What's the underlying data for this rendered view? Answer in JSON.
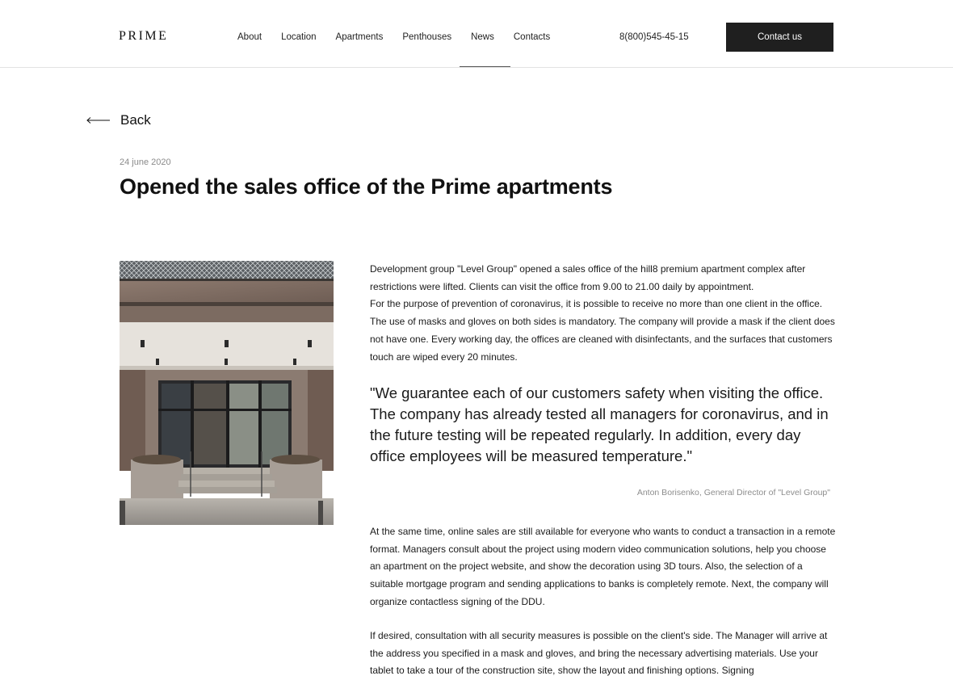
{
  "header": {
    "logo": "PRIME",
    "nav": [
      {
        "label": "About"
      },
      {
        "label": "Location"
      },
      {
        "label": "Apartments"
      },
      {
        "label": "Penthouses"
      },
      {
        "label": "News"
      },
      {
        "label": "Contacts"
      }
    ],
    "active_nav": "News",
    "phone": "8(800)545-45-15",
    "contact_button": "Contact us"
  },
  "back": {
    "label": "Back",
    "icon": "arrow-left-icon"
  },
  "article": {
    "date": "24 june 2020",
    "title": "Opened the sales office of the Prime apartments",
    "image": "sales-office-entrance-photo",
    "paragraph1": "Development group \"Level Group\" opened a sales office of the hill8 premium apartment complex after restrictions were lifted. Clients can visit the office from 9.00 to 21.00 daily by appointment.",
    "paragraph1b": "For the purpose of prevention of coronavirus, it is possible to receive no more than one client in the office. The use of masks and gloves on both sides is mandatory. The company will provide a mask if the client does not have one. Every working day, the offices are cleaned with disinfectants, and the surfaces that customers touch are wiped every 20 minutes.",
    "quote": "\"We guarantee each of our customers safety when visiting the office. The company has already tested all managers for coronavirus, and in the future testing will be repeated regularly. In addition, every day office employees will be measured temperature.\"",
    "quote_author": "Anton Borisenko, General Director of \"Level Group\"",
    "paragraph2": "At the same time, online sales are still available for everyone who wants to conduct a transaction in a remote format. Managers consult about the project using modern video communication solutions, help you choose an apartment on the project website, and show the decoration using 3D tours. Also, the selection of a suitable mortgage program and sending applications to banks is completely remote. Next, the company will organize contactless signing of the DDU.",
    "paragraph3": "If desired, consultation with all security measures is possible on the client's side. The Manager will arrive at the address you specified in a mask and gloves, and bring the necessary advertising materials. Use your tablet to take a tour of the construction site, show the layout and finishing options. Signing"
  },
  "colors": {
    "button_bg": "#1f1f1f",
    "muted_text": "#8a8a8a",
    "divider": "#e3e3e3"
  }
}
